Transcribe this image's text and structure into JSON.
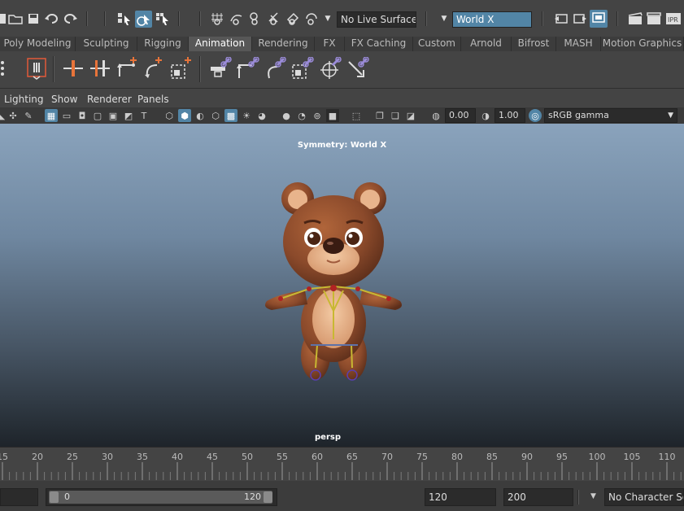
{
  "status_line": {
    "live_surface": "No Live Surface",
    "symmetry": "World X"
  },
  "shelf_tabs": [
    {
      "label": "Poly Modeling",
      "active": false
    },
    {
      "label": "Sculpting",
      "active": false
    },
    {
      "label": "Rigging",
      "active": false
    },
    {
      "label": "Animation",
      "active": true
    },
    {
      "label": "Rendering",
      "active": false
    },
    {
      "label": "FX",
      "active": false
    },
    {
      "label": "FX Caching",
      "active": false
    },
    {
      "label": "Custom",
      "active": false
    },
    {
      "label": "Arnold",
      "active": false
    },
    {
      "label": "Bifrost",
      "active": false
    },
    {
      "label": "MASH",
      "active": false
    },
    {
      "label": "Motion Graphics",
      "active": false
    }
  ],
  "panel_menu": [
    "Lighting",
    "Show",
    "Renderer",
    "Panels"
  ],
  "panel_toolbar": {
    "exposure": "0.00",
    "gamma": "1.00",
    "color_space": "sRGB gamma"
  },
  "viewport": {
    "hud_symmetry": "Symmetry: World X",
    "camera": "persp"
  },
  "time_slider": {
    "labels": [
      "15",
      "20",
      "25",
      "30",
      "35",
      "40",
      "45",
      "50",
      "55",
      "60",
      "65",
      "70",
      "75",
      "80",
      "85",
      "90",
      "95",
      "100",
      "105",
      "110"
    ]
  },
  "range_slider": {
    "range_start": "0",
    "range_end": "120",
    "end_time": "120",
    "max_time": "200",
    "character_set": "No Character Set"
  },
  "colors": {
    "accent": "#5285a6",
    "bear_fur": "#8b4a2b",
    "bear_muzzle": "#e8b48c",
    "joint": "#c8b832"
  }
}
